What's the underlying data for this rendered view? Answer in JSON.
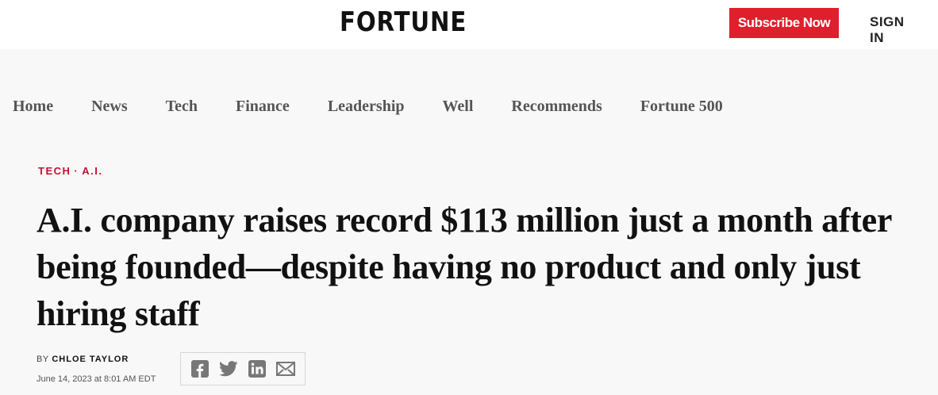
{
  "header": {
    "logo": "FORTUNE",
    "subscribe_label": "Subscribe Now",
    "signin_label": "SIGN IN",
    "accent_color": "#e01f2d"
  },
  "nav": {
    "items": [
      {
        "label": "Home"
      },
      {
        "label": "News"
      },
      {
        "label": "Tech"
      },
      {
        "label": "Finance"
      },
      {
        "label": "Leadership"
      },
      {
        "label": "Well"
      },
      {
        "label": "Recommends"
      },
      {
        "label": "Fortune 500"
      }
    ]
  },
  "article": {
    "kicker_section": "TECH",
    "kicker_separator": "·",
    "kicker_topic": "A.I.",
    "headline": "A.I. company raises record $113 million just a month after being founded—despite having no product and only just hiring staff",
    "byline_prefix": "BY",
    "author": "CHLOE TAYLOR",
    "date": "June 14, 2023 at 8:01 AM EDT"
  },
  "share": {
    "icons": [
      "facebook-icon",
      "twitter-icon",
      "linkedin-icon",
      "email-icon"
    ]
  }
}
